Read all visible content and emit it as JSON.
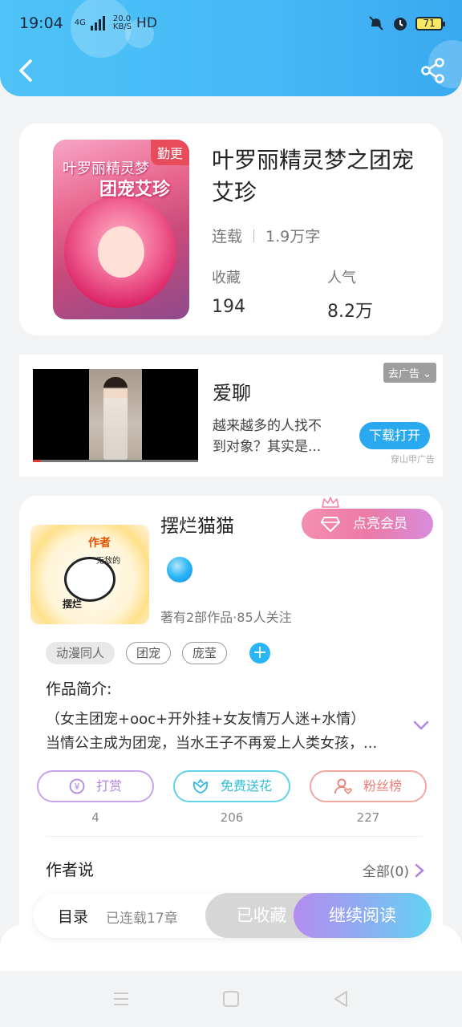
{
  "status_bar": {
    "time": "19:04",
    "network": "4G",
    "speed": "20.0",
    "speed_unit": "KB/S",
    "hd": "HD",
    "battery": "71"
  },
  "book": {
    "title": "叶罗丽精灵梦之团宠艾珍",
    "cover_tag": "勤更",
    "cover_line1": "叶罗丽精灵梦",
    "cover_line2": "团宠艾珍",
    "status": "连载",
    "word_count": "1.9万字",
    "favorites_label": "收藏",
    "favorites_value": "194",
    "popularity_label": "人气",
    "popularity_value": "8.2万"
  },
  "ad": {
    "remove_label": "去广告",
    "name": "爱聊",
    "desc": "越来越多的人找不到对象？其实是...",
    "download_label": "下载打开",
    "source": "穿山甲广告"
  },
  "author": {
    "name": "摆烂猫猫",
    "vip_label": "点亮会员",
    "avatar_text1": "作者",
    "avatar_text2": "无敌的",
    "avatar_text3": "摆烂",
    "meta": "著有2部作品·85人关注",
    "tags": [
      "动漫同人",
      "团宠",
      "庞莹"
    ],
    "intro_label": "作品简介:",
    "intro_line1": "（女主团宠+ooc+开外挂+女友情万人迷+水情）",
    "intro_line2": "当情公主成为团宠，当水王子不再爱上人类女孩，...",
    "actions": [
      {
        "label": "打赏",
        "count": "4"
      },
      {
        "label": "免费送花",
        "count": "206"
      },
      {
        "label": "粉丝榜",
        "count": "227"
      }
    ],
    "author_says_label": "作者说",
    "all_label": "全部(0)"
  },
  "bottom_bar": {
    "toc_label": "目录",
    "chapters": "已连载17章",
    "favorited_label": "已收藏",
    "continue_label": "继续阅读"
  }
}
